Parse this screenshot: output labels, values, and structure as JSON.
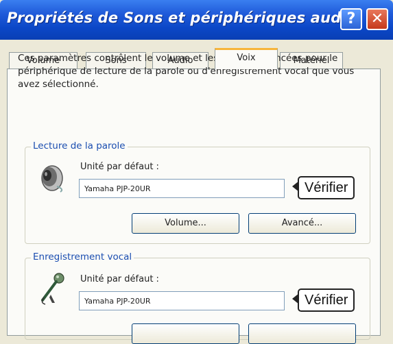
{
  "window": {
    "title": "Propriétés de Sons et périphériques audio",
    "help_label": "?",
    "close_label": "✕"
  },
  "tabs": [
    {
      "label": "Volume"
    },
    {
      "label": "Sons"
    },
    {
      "label": "Audio"
    },
    {
      "label": "Voix",
      "active": true
    },
    {
      "label": "Matériel"
    }
  ],
  "description": "Ces paramètres contrôlent le volume et les options avancées pour le périphérique de lecture de la parole ou d'enregistrement vocal que vous avez sélectionné.",
  "playback": {
    "legend": "Lecture de la parole",
    "icon": "speaker-icon",
    "device_label": "Unité par défaut :",
    "device_value": "Yamaha PJP-20UR",
    "callout": "Vérifier",
    "volume_button": "Volume...",
    "advanced_button": "Avancé..."
  },
  "recording": {
    "legend": "Enregistrement vocal",
    "icon": "microphone-icon",
    "device_label": "Unité par défaut :",
    "device_value": "Yamaha PJP-20UR",
    "callout": "Vérifier"
  }
}
